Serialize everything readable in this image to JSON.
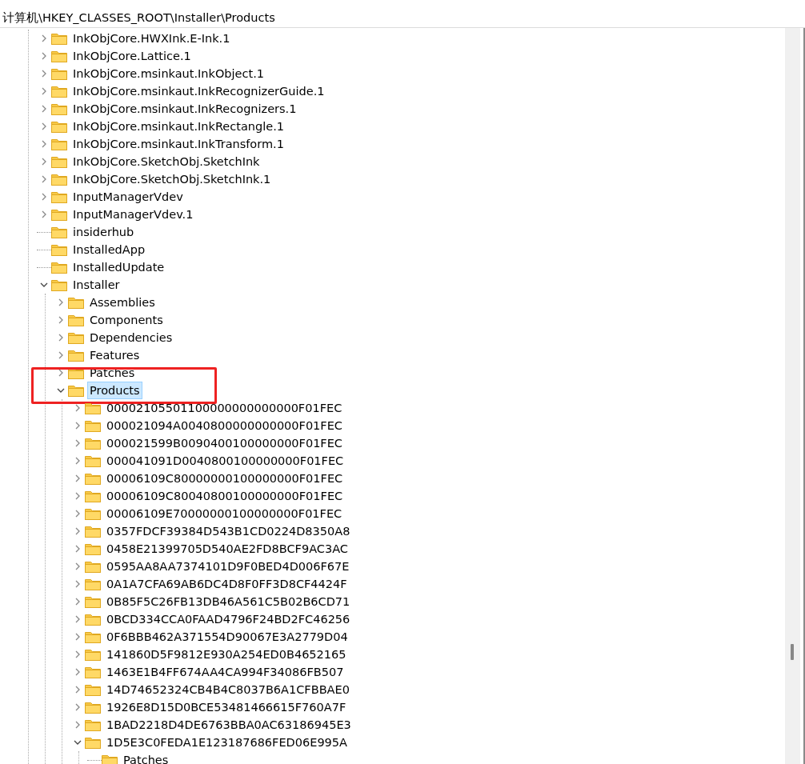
{
  "address_bar": {
    "path": "计算机\\HKEY_CLASSES_ROOT\\Installer\\Products"
  },
  "tree": [
    {
      "label": "InkObjCore.HWXInk.E-Ink.1",
      "expandable": true,
      "expanded": false,
      "selected": false
    },
    {
      "label": "InkObjCore.Lattice.1",
      "expandable": true,
      "expanded": false,
      "selected": false
    },
    {
      "label": "InkObjCore.msinkaut.InkObject.1",
      "expandable": true,
      "expanded": false,
      "selected": false
    },
    {
      "label": "InkObjCore.msinkaut.InkRecognizerGuide.1",
      "expandable": true,
      "expanded": false,
      "selected": false
    },
    {
      "label": "InkObjCore.msinkaut.InkRecognizers.1",
      "expandable": true,
      "expanded": false,
      "selected": false
    },
    {
      "label": "InkObjCore.msinkaut.InkRectangle.1",
      "expandable": true,
      "expanded": false,
      "selected": false
    },
    {
      "label": "InkObjCore.msinkaut.InkTransform.1",
      "expandable": true,
      "expanded": false,
      "selected": false
    },
    {
      "label": "InkObjCore.SketchObj.SketchInk",
      "expandable": true,
      "expanded": false,
      "selected": false
    },
    {
      "label": "InkObjCore.SketchObj.SketchInk.1",
      "expandable": true,
      "expanded": false,
      "selected": false
    },
    {
      "label": "InputManagerVdev",
      "expandable": true,
      "expanded": false,
      "selected": false
    },
    {
      "label": "InputManagerVdev.1",
      "expandable": true,
      "expanded": false,
      "selected": false
    },
    {
      "label": "insiderhub",
      "expandable": false,
      "selected": false
    },
    {
      "label": "InstalledApp",
      "expandable": false,
      "selected": false
    },
    {
      "label": "InstalledUpdate",
      "expandable": false,
      "selected": false
    },
    {
      "label": "Installer",
      "expandable": true,
      "expanded": true,
      "selected": false,
      "children": [
        {
          "label": "Assemblies",
          "expandable": true,
          "expanded": false,
          "selected": false
        },
        {
          "label": "Components",
          "expandable": true,
          "expanded": false,
          "selected": false
        },
        {
          "label": "Dependencies",
          "expandable": true,
          "expanded": false,
          "selected": false
        },
        {
          "label": "Features",
          "expandable": true,
          "expanded": false,
          "selected": false
        },
        {
          "label": "Patches",
          "expandable": true,
          "expanded": false,
          "selected": false
        },
        {
          "label": "Products",
          "expandable": true,
          "expanded": true,
          "selected": true,
          "highlighted": true,
          "children": [
            {
              "label": "00002105501100000000000000F01FEC",
              "expandable": true,
              "expanded": false,
              "selected": false
            },
            {
              "label": "000021094A0040800000000000F01FEC",
              "expandable": true,
              "expanded": false,
              "selected": false
            },
            {
              "label": "000021599B0090400100000000F01FEC",
              "expandable": true,
              "expanded": false,
              "selected": false
            },
            {
              "label": "000041091D0040800100000000F01FEC",
              "expandable": true,
              "expanded": false,
              "selected": false
            },
            {
              "label": "00006109C80000000100000000F01FEC",
              "expandable": true,
              "expanded": false,
              "selected": false
            },
            {
              "label": "00006109C80040800100000000F01FEC",
              "expandable": true,
              "expanded": false,
              "selected": false
            },
            {
              "label": "00006109E70000000100000000F01FEC",
              "expandable": true,
              "expanded": false,
              "selected": false
            },
            {
              "label": "0357FDCF39384D543B1CD0224D8350A8",
              "expandable": true,
              "expanded": false,
              "selected": false
            },
            {
              "label": "0458E21399705D540AE2FD8BCF9AC3AC",
              "expandable": true,
              "expanded": false,
              "selected": false
            },
            {
              "label": "0595AA8AA7374101D9F0BED4D006F67E",
              "expandable": true,
              "expanded": false,
              "selected": false
            },
            {
              "label": "0A1A7CFA69AB6DC4D8F0FF3D8CF4424F",
              "expandable": true,
              "expanded": false,
              "selected": false
            },
            {
              "label": "0B85F5C26FB13DB46A561C5B02B6CD71",
              "expandable": true,
              "expanded": false,
              "selected": false
            },
            {
              "label": "0BCD334CCA0FAAD4796F24BD2FC46256",
              "expandable": true,
              "expanded": false,
              "selected": false
            },
            {
              "label": "0F6BBB462A371554D90067E3A2779D04",
              "expandable": true,
              "expanded": false,
              "selected": false
            },
            {
              "label": "141860D5F9812E930A254ED0B4652165",
              "expandable": true,
              "expanded": false,
              "selected": false
            },
            {
              "label": "1463E1B4FF674AA4CA994F34086FB507",
              "expandable": true,
              "expanded": false,
              "selected": false
            },
            {
              "label": "14D74652324CB4B4C8037B6A1CFBBAE0",
              "expandable": true,
              "expanded": false,
              "selected": false
            },
            {
              "label": "1926E8D15D0BCE53481466615F760A7F",
              "expandable": true,
              "expanded": false,
              "selected": false
            },
            {
              "label": "1BAD2218D4DE6763BBA0AC63186945E3",
              "expandable": true,
              "expanded": false,
              "selected": false
            },
            {
              "label": "1D5E3C0FEDA1E123187686FED06E995A",
              "expandable": true,
              "expanded": true,
              "selected": false,
              "children": [
                {
                  "label": "Patches",
                  "expandable": false,
                  "selected": false
                }
              ]
            }
          ]
        }
      ]
    }
  ]
}
